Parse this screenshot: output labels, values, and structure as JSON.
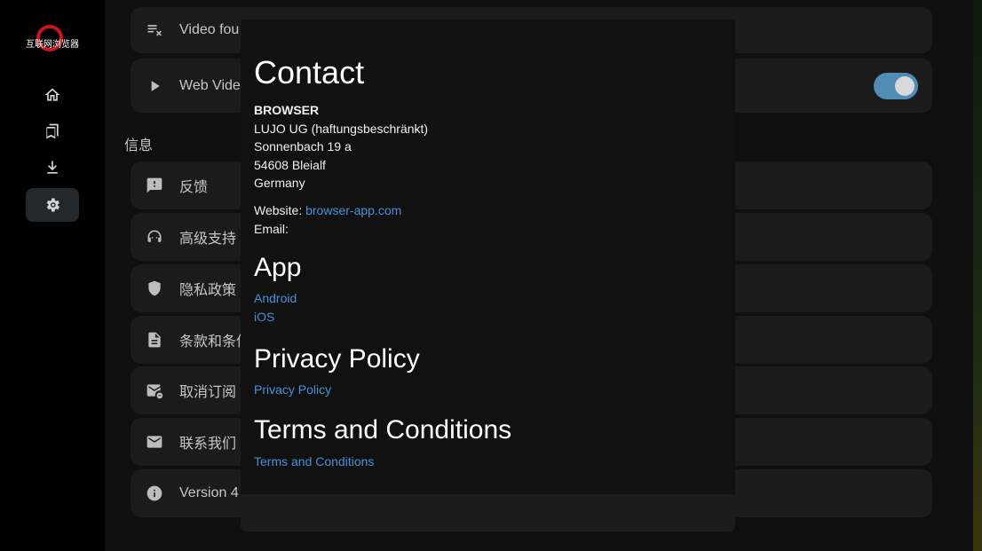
{
  "logo": {
    "text": "互联网浏览器"
  },
  "sidebar": {
    "items": [
      {
        "name": "home",
        "icon": "home-icon"
      },
      {
        "name": "bookmarks",
        "icon": "bookmarks-icon"
      },
      {
        "name": "downloads",
        "icon": "download-icon"
      },
      {
        "name": "settings",
        "icon": "gear-icon",
        "active": true
      }
    ]
  },
  "settings": {
    "video_found": "Video fou",
    "web_video": "Web Vide",
    "web_video_toggle": true,
    "section_info": "信息",
    "items": [
      {
        "label": "反馈",
        "icon": "feedback-icon"
      },
      {
        "label": "高级支持",
        "icon": "support-icon"
      },
      {
        "label": "隐私政策",
        "icon": "shield-icon"
      },
      {
        "label": "条款和条件",
        "icon": "document-icon"
      },
      {
        "label": "取消订阅",
        "icon": "unsubscribe-icon"
      },
      {
        "label": "联系我们",
        "icon": "mail-icon"
      },
      {
        "label": "Version 4",
        "icon": "info-icon"
      }
    ]
  },
  "modal": {
    "contact_title": "Contact",
    "company_name": "BROWSER",
    "company_legal": "LUJO UG (haftungsbeschränkt)",
    "street": "Sonnenbach 19 a",
    "city": "54608 Bleialf",
    "country": "Germany",
    "website_label": "Website:",
    "website_link": "browser-app.com",
    "email_label": "Email:",
    "app_title": "App",
    "android_link": "Android",
    "ios_link": "iOS",
    "privacy_title": "Privacy Policy",
    "privacy_link": "Privacy Policy",
    "terms_title": "Terms and Conditions",
    "terms_link": "Terms and Conditions"
  },
  "colors": {
    "accent": "#4a90d9",
    "toggle_on": "#4f8db5",
    "logo_red": "#c8161d"
  }
}
